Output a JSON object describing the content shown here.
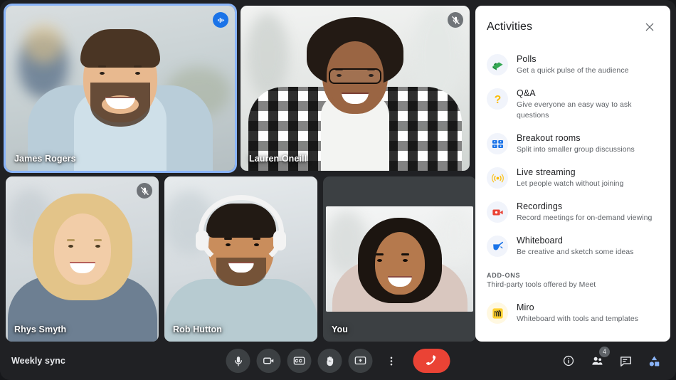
{
  "meeting": {
    "title": "Weekly sync",
    "participant_count": "4"
  },
  "tiles": [
    {
      "name": "James Rogers",
      "mic_state": "speaking",
      "mic_icon": "volume-bars-icon",
      "active_speaker": true
    },
    {
      "name": "Lauren Oneill",
      "mic_state": "muted",
      "mic_icon": "mic-off-icon",
      "active_speaker": false
    },
    {
      "name": "Rhys Smyth",
      "mic_state": "muted",
      "mic_icon": "mic-off-icon",
      "active_speaker": false
    },
    {
      "name": "Rob Hutton",
      "mic_state": "none",
      "mic_icon": "",
      "active_speaker": false
    },
    {
      "name": "You",
      "mic_state": "none",
      "mic_icon": "",
      "active_speaker": false
    }
  ],
  "panel": {
    "title": "Activities",
    "close_icon": "close-icon",
    "activities": [
      {
        "icon": "poll-icon",
        "title": "Polls",
        "description": "Get a quick pulse of the audience"
      },
      {
        "icon": "question-mark-icon",
        "title": "Q&A",
        "description": "Give everyone an easy way to ask questions"
      },
      {
        "icon": "breakout-rooms-icon",
        "title": "Breakout rooms",
        "description": "Split into smaller group discussions"
      },
      {
        "icon": "live-streaming-icon",
        "title": "Live streaming",
        "description": "Let people watch without joining"
      },
      {
        "icon": "recording-camera-icon",
        "title": "Recordings",
        "description": "Record meetings for on-demand viewing"
      },
      {
        "icon": "whiteboard-pen-icon",
        "title": "Whiteboard",
        "description": "Be creative and sketch some ideas"
      }
    ],
    "addons_section": {
      "label": "ADD-ONS",
      "subtitle": "Third-party tools offered by Meet"
    },
    "addons": [
      {
        "icon": "miro-icon",
        "title": "Miro",
        "description": "Whiteboard with tools and templates"
      }
    ]
  },
  "toolbar": {
    "center": [
      {
        "icon": "microphone-icon",
        "name": "mic-toggle-button"
      },
      {
        "icon": "camera-icon",
        "name": "camera-toggle-button"
      },
      {
        "icon": "captions-icon",
        "name": "captions-button"
      },
      {
        "icon": "raise-hand-icon",
        "name": "raise-hand-button"
      },
      {
        "icon": "present-screen-icon",
        "name": "present-now-button"
      },
      {
        "icon": "more-options-icon",
        "name": "more-options-button"
      }
    ],
    "hangup": {
      "icon": "end-call-icon",
      "name": "leave-call-button"
    },
    "right": [
      {
        "icon": "info-icon",
        "name": "meeting-details-button"
      },
      {
        "icon": "people-icon",
        "name": "participants-button"
      },
      {
        "icon": "chat-bubble-icon",
        "name": "chat-button"
      },
      {
        "icon": "activities-icon",
        "name": "activities-button"
      }
    ]
  },
  "colors": {
    "accent_blue": "#8ab4f8",
    "active_blue": "#1a73e8",
    "hangup_red": "#ea4335",
    "panel_bg": "#ffffff",
    "app_bg": "#202124"
  }
}
